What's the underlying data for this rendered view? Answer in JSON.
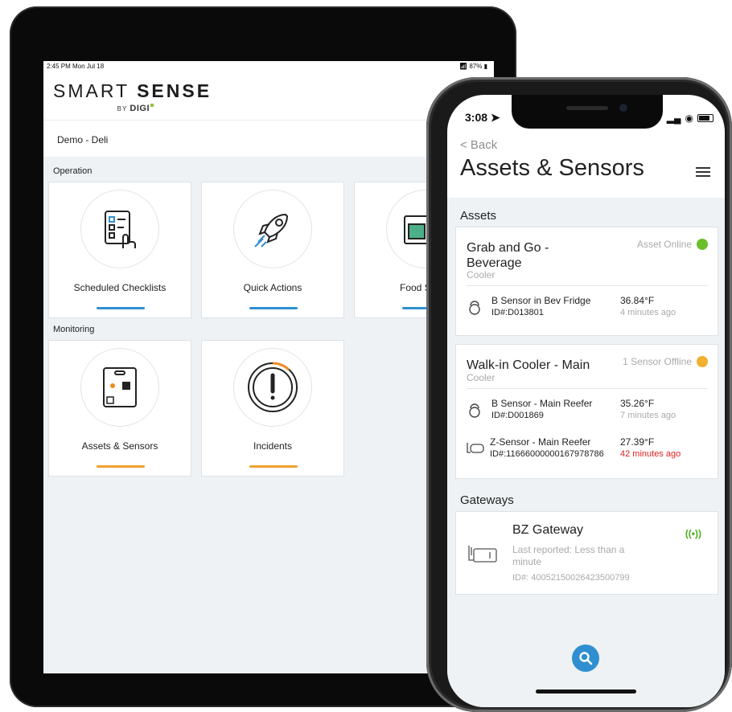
{
  "tablet": {
    "status_left": "2:45 PM  Mon Jul 18",
    "status_right": "87%",
    "logo_word1": "SMART",
    "logo_word2": "SENSE",
    "logo_by": "BY",
    "logo_brand": "DIGI",
    "location": "Demo - Deli",
    "operation_label": "Operation",
    "monitoring_label": "Monitoring",
    "tiles": [
      {
        "label": "Scheduled Checklists",
        "icon": "checklist-icon"
      },
      {
        "label": "Quick Actions",
        "icon": "rocket-icon"
      },
      {
        "label": "Food Sa",
        "icon": "food-safety-icon"
      },
      {
        "label": "Assets & Sensors",
        "icon": "sensor-device-icon"
      },
      {
        "label": "Incidents",
        "icon": "alert-icon"
      }
    ],
    "colors": {
      "operation_bar": "#2f8fd0",
      "monitoring_bar": "#f0a030"
    }
  },
  "phone": {
    "time": "3:08",
    "back": "< Back",
    "title": "Assets & Sensors",
    "assets_label": "Assets",
    "gateways_label": "Gateways",
    "assets": [
      {
        "name": "Grab and Go -\nBeverage",
        "type": "Cooler",
        "status": "Asset Online",
        "status_color": "#6abf2a",
        "sensors": [
          {
            "name": "B Sensor in Bev Fridge",
            "id": "ID#:D013801",
            "temp": "36.84°F",
            "ago": "4 minutes ago",
            "icon": "b-sensor-icon"
          }
        ]
      },
      {
        "name": "Walk-in Cooler - Main",
        "type": "Cooler",
        "status": "1 Sensor Offline",
        "status_color": "#f0b030",
        "sensors": [
          {
            "name": "B Sensor - Main Reefer",
            "id": "ID#:D001869",
            "temp": "35.26°F",
            "ago": "7 minutes ago",
            "icon": "b-sensor-icon"
          },
          {
            "name": "Z-Sensor - Main Reefer",
            "id": "ID#:11666000000167978786",
            "temp": "27.39°F",
            "ago": "42 minutes ago",
            "ago_color": "#e02020",
            "icon": "z-sensor-icon"
          }
        ]
      }
    ],
    "gateway": {
      "name": "BZ Gateway",
      "reported": "Last reported: Less than a minute",
      "id": "ID#: 40052150026423500799",
      "signal": "((•))",
      "icon": "gateway-icon"
    }
  }
}
